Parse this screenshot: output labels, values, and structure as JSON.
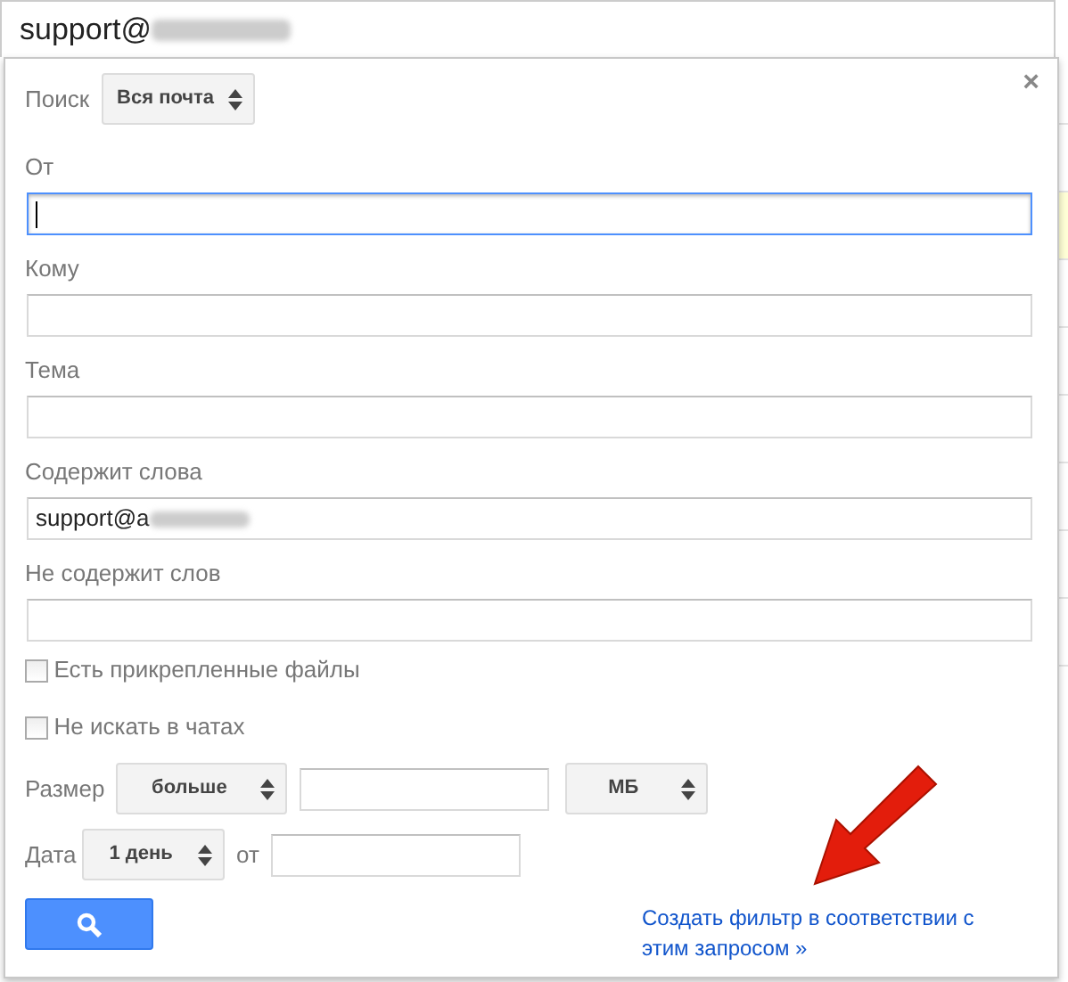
{
  "search_bar": {
    "value": "support@",
    "redacted": true
  },
  "panel": {
    "close": "×",
    "scope": {
      "label": "Поиск",
      "value": "Вся почта"
    },
    "fields": [
      {
        "label": "От",
        "focused": true
      },
      {
        "label": "Кому",
        "focused": false
      },
      {
        "label": "Тема",
        "focused": false
      },
      {
        "label": "Содержит слова",
        "value": "support@a",
        "redacted": true,
        "focused": false
      },
      {
        "label": "Не содержит слов",
        "focused": false
      }
    ],
    "checkboxes": [
      {
        "label": "Есть прикрепленные файлы",
        "checked": false
      },
      {
        "label": "Не искать в чатах",
        "checked": false
      }
    ],
    "size": {
      "label": "Размер",
      "operator": "больше",
      "unit": "МБ"
    },
    "date": {
      "label": "Дата",
      "range": "1 день",
      "from_label": "от"
    },
    "filter_link": "Создать фильтр в соответствии с этим запросом »"
  }
}
